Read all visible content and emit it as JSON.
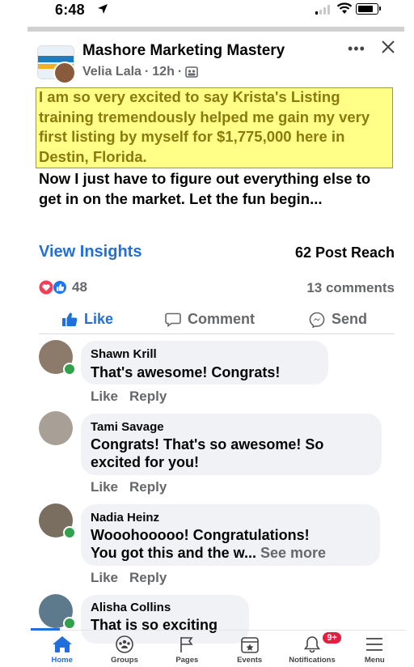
{
  "status_bar": {
    "time": "6:48"
  },
  "header": {
    "group_name": "Mashore Marketing Mastery",
    "author": "Velia Lala",
    "time_ago": "12h",
    "separator": "·"
  },
  "post": {
    "highlighted_text": "I am so very excited to say Krista's Listing training tremendously helped me gain my very first listing by myself for $1,775,000 here in Destin, Florida.",
    "text": "Now I just have to figure out everything else to get in on the market.  Let the fun begin...",
    "insights_label": "View Insights",
    "reach_label": "62 Post Reach",
    "reaction_count": "48",
    "comments_count": "13 comments"
  },
  "actions": {
    "like": "Like",
    "comment": "Comment",
    "send": "Send"
  },
  "comments": [
    {
      "name": "Shawn Krill",
      "text": "That's awesome! Congrats!",
      "like": "Like",
      "reply": "Reply"
    },
    {
      "name": "Tami Savage",
      "text_line1": "Congrats!  That's so awesome! So",
      "text_line2": "excited for you!",
      "like": "Like",
      "reply": "Reply"
    },
    {
      "name": "Nadia Heinz",
      "text_line1": "Wooohooooo! Congratulations!",
      "text_line2": "You got this and the w... ",
      "see_more": "See more",
      "like": "Like",
      "reply": "Reply"
    },
    {
      "name": "Alisha Collins",
      "text": "That is so exciting"
    }
  ],
  "nav": {
    "items": [
      {
        "label": "Home",
        "icon": "home-icon"
      },
      {
        "label": "Groups",
        "icon": "groups-icon"
      },
      {
        "label": "Pages",
        "icon": "flag-icon"
      },
      {
        "label": "Events",
        "icon": "calendar-icon"
      },
      {
        "label": "Notifications",
        "icon": "bell-icon",
        "badge": "9+"
      },
      {
        "label": "Menu",
        "icon": "hamburger-icon"
      }
    ]
  },
  "colors": {
    "accent": "#216fdb",
    "highlight": "#ffff88",
    "online": "#31a24c",
    "badge": "#e41e3f"
  }
}
